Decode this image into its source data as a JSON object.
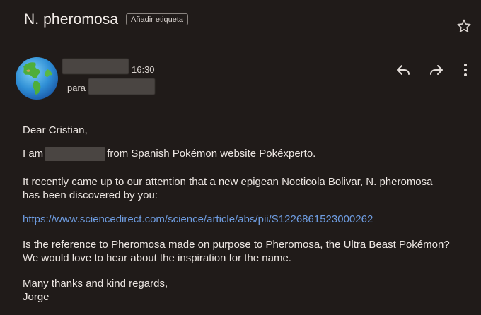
{
  "header": {
    "subject": "N. pheromosa",
    "label_chip": "Añadir etiqueta",
    "star_icon": "star-outline-icon"
  },
  "message": {
    "sender_redacted": true,
    "time": "16:30",
    "to_prefix": "para",
    "actions": [
      "reply-icon",
      "forward-icon",
      "more-vert-icon"
    ]
  },
  "body": {
    "greeting": "Dear Cristian,",
    "intro_before": "I am",
    "intro_after": "from Spanish Pokémon website Pokéxperto.",
    "para2_line1": "It recently came up to our attention that a new epigean Nocticola Bolivar, N. pheromosa",
    "para2_line2": "has been discovered by you:",
    "link": "https://www.sciencedirect.com/science/article/abs/pii/S1226861523000262",
    "para3_line1": "Is the reference to Pheromosa made on purpose to Pheromosa, the Ultra Beast Pokémon?",
    "para3_line2": "We would love to hear about the inspiration for the name.",
    "closing": "Many thanks and kind regards,",
    "signature": "Jorge"
  }
}
